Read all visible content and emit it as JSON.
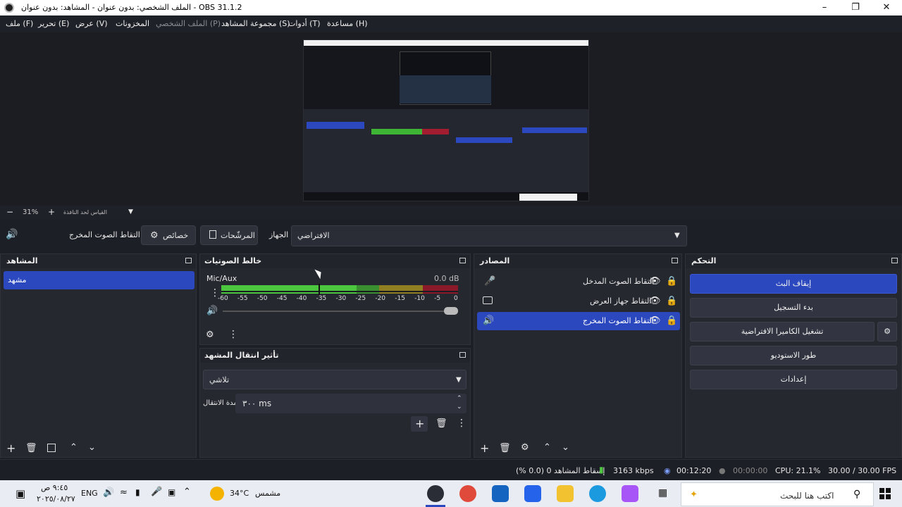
{
  "window": {
    "title": "OBS 31.1.2 - الملف الشخصي: بدون عنوان - المشاهد: بدون عنوان"
  },
  "menu": {
    "file": "ملف (F)",
    "edit": "تحرير (E)",
    "view": "عرض (V)",
    "docks": "المخزونات",
    "profile": "الملف الشخصي (P)",
    "scene_collection": "مجموعة المشاهد (S)",
    "tools": "أدوات (T)",
    "help": "مساعدة (H)"
  },
  "preview": {
    "zoom": "31%",
    "scale_mode": "القياس لحد النافذة"
  },
  "audio_device_bar": {
    "source_name": "التقاط الصوت المخرج",
    "properties": "خصائص",
    "filters": "المرشّحات",
    "device_label": "الجهاز",
    "device_value": "الافتراضي"
  },
  "scenes": {
    "title": "المشاهد",
    "items": [
      "مشهد"
    ]
  },
  "mixer": {
    "title": "خالط الصوتيات",
    "channel": "Mic/Aux",
    "level": "0.0 dB",
    "ticks": [
      "-60",
      "-55",
      "-50",
      "-45",
      "-40",
      "-35",
      "-30",
      "-25",
      "-20",
      "-15",
      "-10",
      "-5",
      "0"
    ]
  },
  "transitions": {
    "title": "تأثير انتقال المشهد",
    "type": "تلاشي",
    "duration_label": "مدة الانتقال",
    "duration_value": "٣٠٠ ms"
  },
  "sources": {
    "title": "المصادر",
    "items": [
      {
        "name": "التقاط الصوت المدخل",
        "icon": "microphone-icon"
      },
      {
        "name": "التقاط جهاز العرض",
        "icon": "monitor-icon"
      },
      {
        "name": "التقاط الصوت المخرج",
        "icon": "speaker-icon"
      }
    ]
  },
  "controls": {
    "title": "التحكم",
    "stop_stream": "إيقاف البث",
    "start_recording": "بدء التسجيل",
    "virtual_camera": "تشغيل الكاميرا الافتراضية",
    "studio_mode": "طور الاستوديو",
    "settings": "إعدادات"
  },
  "status": {
    "dropped": "إسقاط المشاهد 0 (0.0 %)",
    "bitrate": "3163 kbps",
    "stream_time": "00:12:20",
    "rec_time": "00:00:00",
    "cpu": "CPU: 21.1%",
    "fps": "30.00 / 30.00 FPS"
  },
  "taskbar": {
    "search_placeholder": "اكتب هنا للبحث",
    "weather_temp": "34°C",
    "weather_desc": "مشمس",
    "lang": "ENG",
    "time": "٩:٤٥ ص",
    "date": "٢٠٢٥/٠٨/٢٧"
  },
  "colors": {
    "accent": "#2b48bf",
    "meter_green": "#4cc63f",
    "meter_yellow": "#b7a431",
    "meter_red": "#a31d30"
  }
}
